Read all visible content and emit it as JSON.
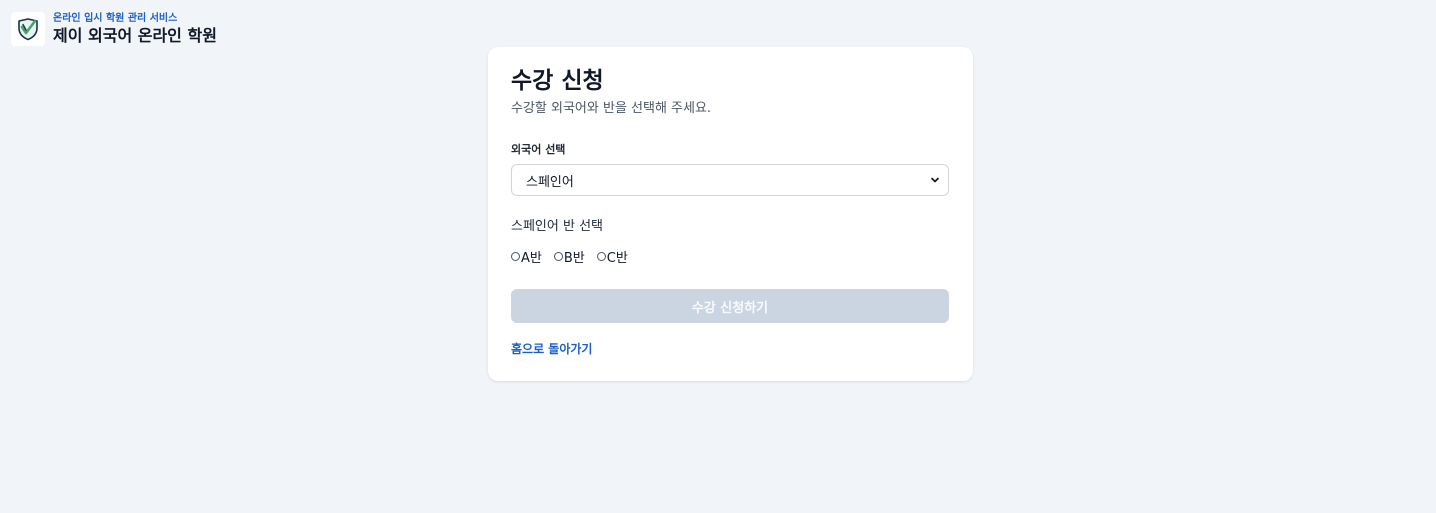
{
  "header": {
    "subtitle": "온라인 입시 학원 관리 서비스",
    "title": "제이 외국어 온라인 학원",
    "logo_icon": "shield-check-icon"
  },
  "form": {
    "title": "수강 신청",
    "description": "수강할 외국어와 반을 선택해 주세요.",
    "language_label": "외국어 선택",
    "selected_language": "스페인어",
    "class_section_title": "스페인어 반 선택",
    "class_options": [
      {
        "label": "A반",
        "selected": false
      },
      {
        "label": "B반",
        "selected": false
      },
      {
        "label": "C반",
        "selected": false
      }
    ],
    "submit_label": "수강 신청하기",
    "submit_enabled": false,
    "home_link_label": "홈으로 돌아가기"
  },
  "colors": {
    "background": "#f1f4f8",
    "accent": "#1d5fc9",
    "logo_green": "#4aa36c",
    "logo_dark": "#17324d",
    "button_disabled": "#cbd5e1"
  }
}
